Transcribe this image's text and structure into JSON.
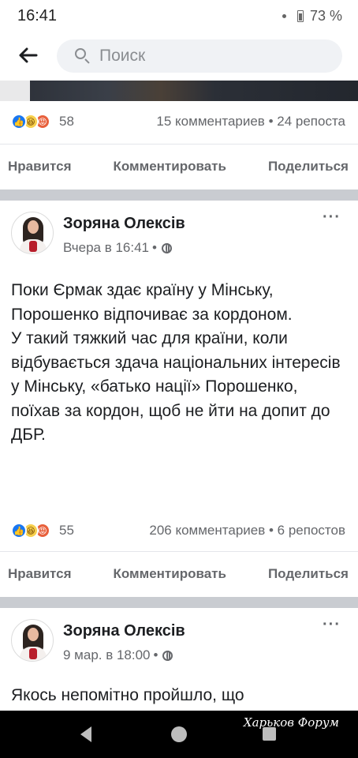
{
  "status_bar": {
    "time": "16:41",
    "battery": "73 %"
  },
  "search": {
    "placeholder": "Поиск"
  },
  "icons": {
    "back": "arrow-left-icon",
    "search": "search-icon",
    "reaction_like": "like-icon",
    "reaction_haha": "haha-icon",
    "reaction_angry": "angry-icon",
    "privacy": "globe-icon",
    "more": "more-dots-icon"
  },
  "colors": {
    "like": "#1877f2",
    "haha": "#f7d04d",
    "angry": "#e8603c",
    "text": "#1c1e21",
    "muted": "#65676b"
  },
  "posts": [
    {
      "reactions": "58",
      "stats": "15 комментариев • 24 репоста",
      "actions": {
        "like": "Нравится",
        "comment": "Комментировать",
        "share": "Поделиться"
      }
    },
    {
      "author": "Зоряна Олексів",
      "time": "Вчера в 16:41",
      "dot": "•",
      "more": "···",
      "paragraphs": [
        "Поки Єрмак здає країну у Мінську, Порошенко відпочиває за кордоном.",
        "У  такий тяжкий час для країни, коли відбувається здача національних інтересів у Мінську, «батько нації» Порошенко, поїхав за кордон, щоб не йти на допит до ДБР."
      ],
      "reactions": "55",
      "stats": "206 комментариев • 6 репостов",
      "actions": {
        "like": "Нравится",
        "comment": "Комментировать",
        "share": "Поделиться"
      }
    },
    {
      "author": "Зоряна Олексів",
      "time": "9 мар. в 18:00",
      "dot": "•",
      "more": "···",
      "paragraphs": [
        "Якось непомітно пройшло, що"
      ]
    }
  ],
  "watermark": "Харьков Форум"
}
